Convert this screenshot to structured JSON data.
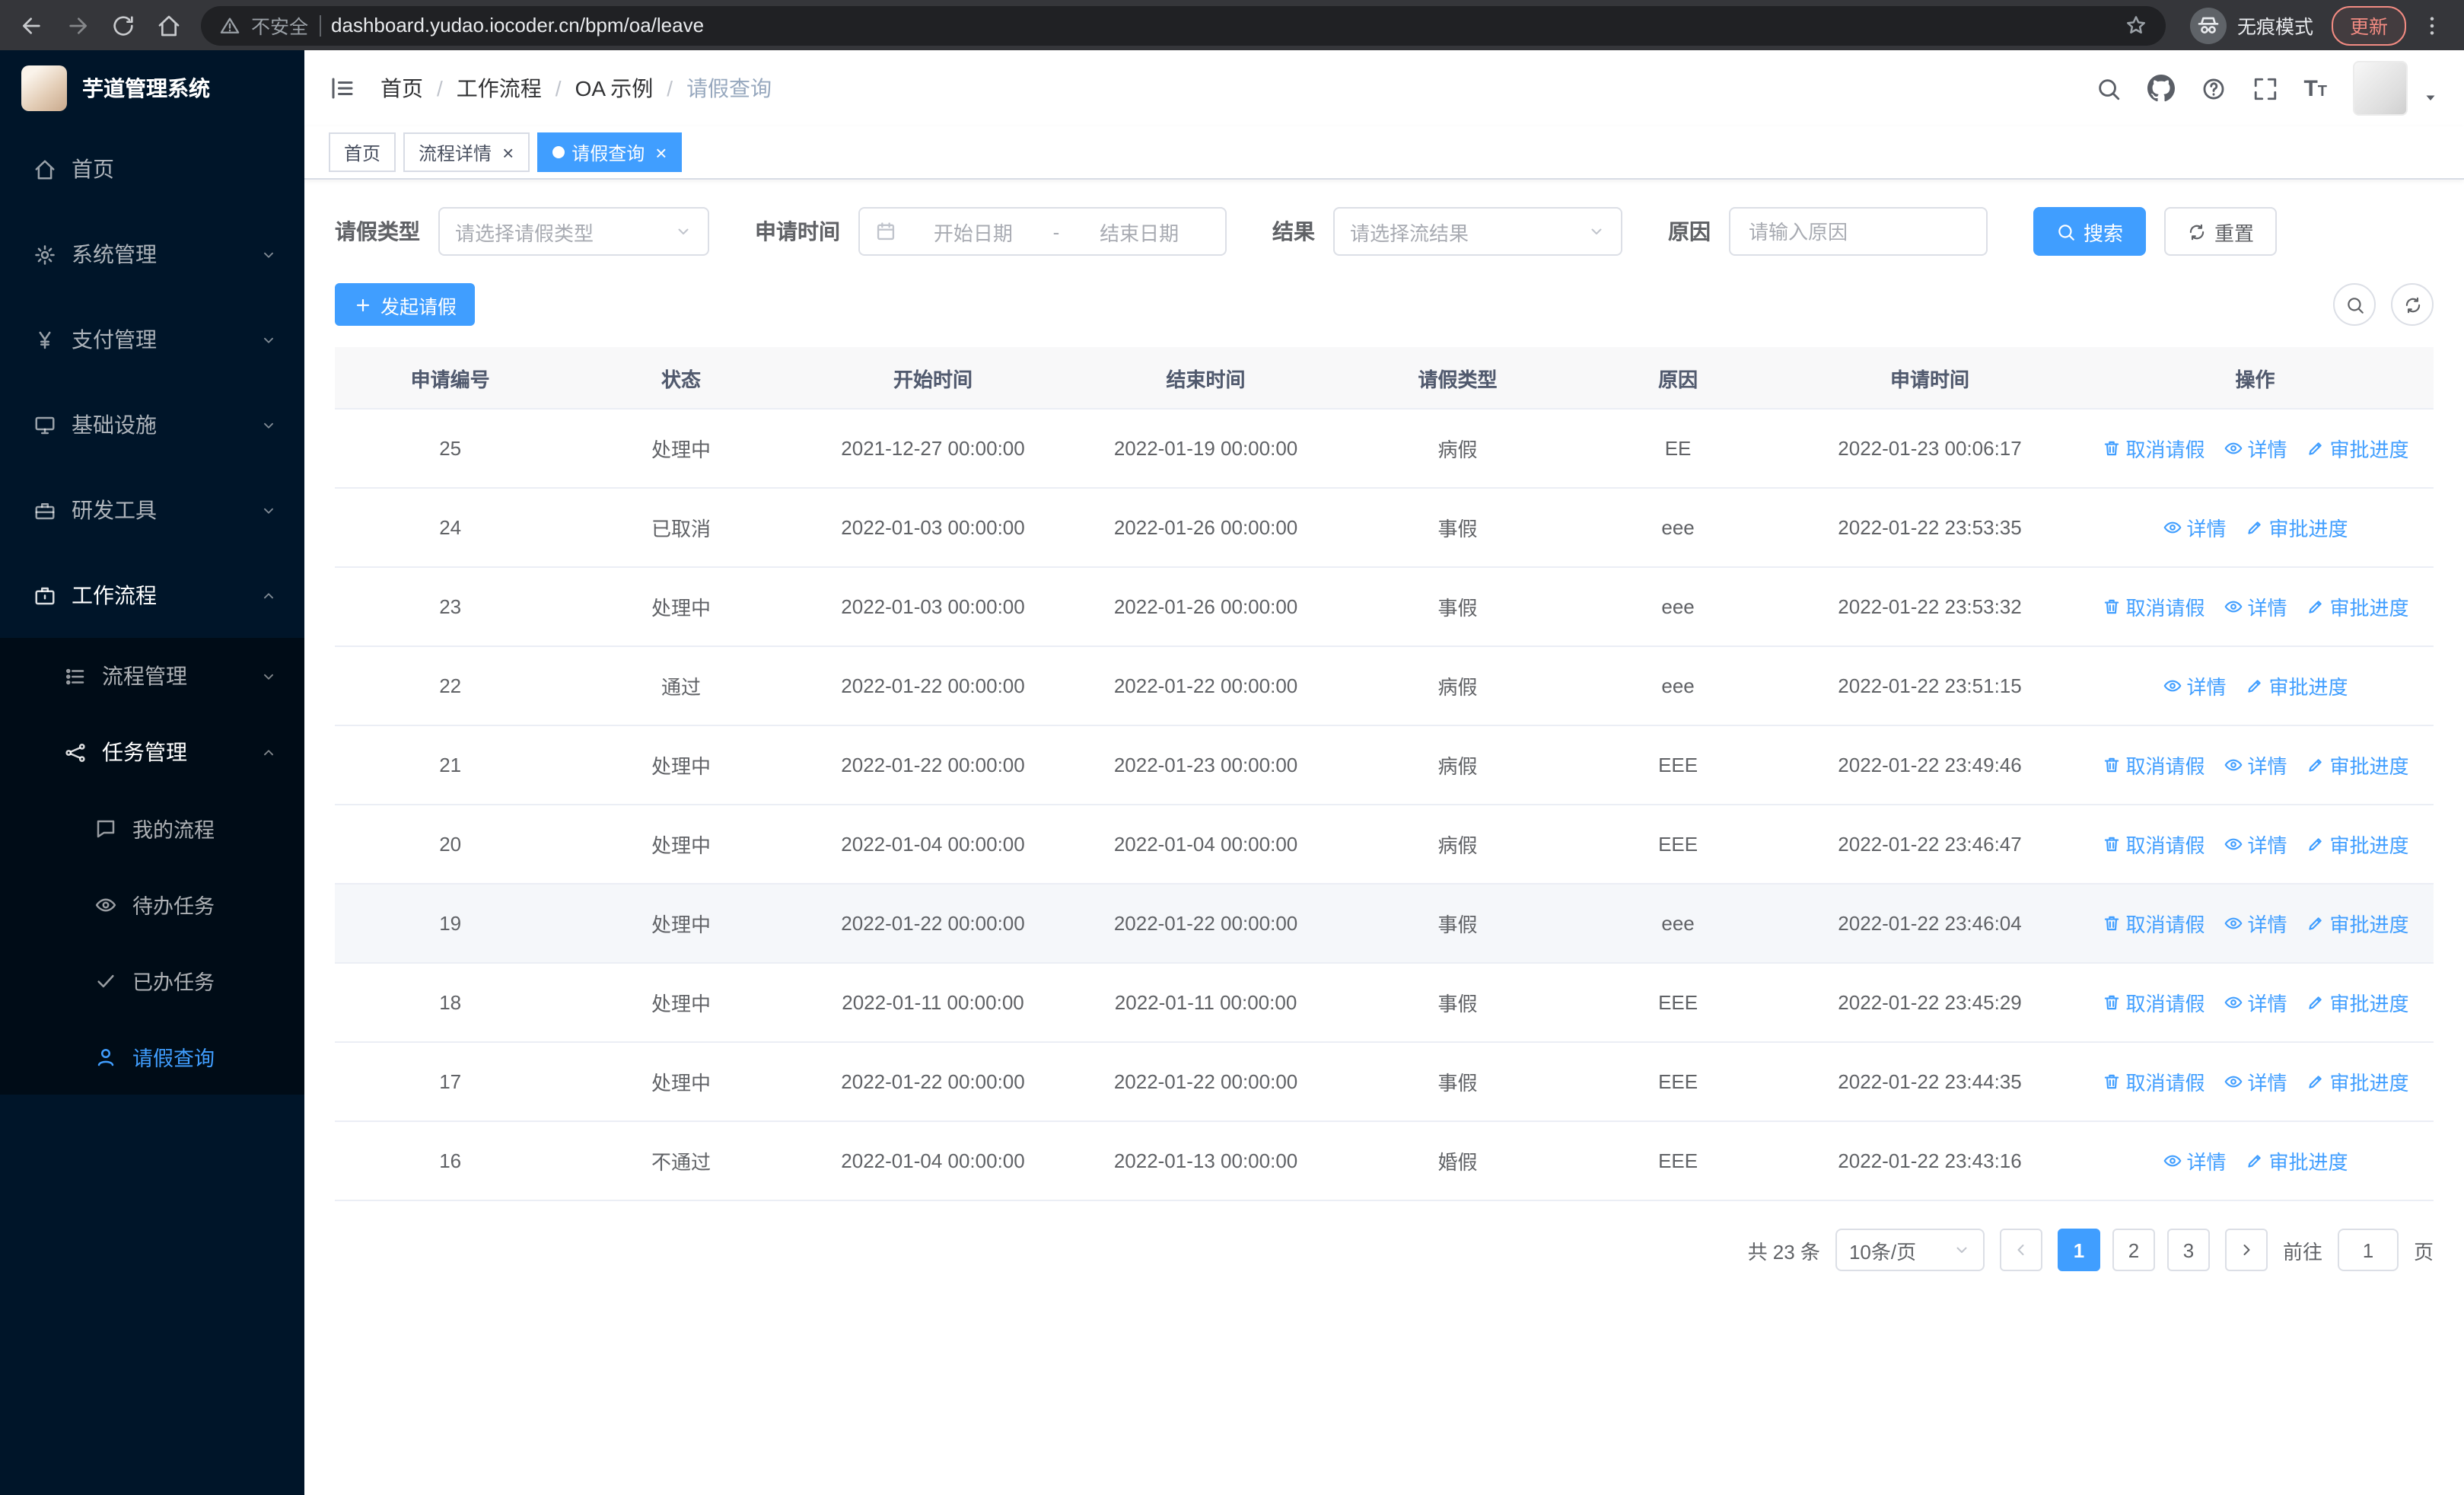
{
  "colors": {
    "accent": "#409eff",
    "sidebar_bg": "#001529",
    "submenu_bg": "#000c17"
  },
  "browser": {
    "security_label": "不安全",
    "url": "dashboard.yudao.iocoder.cn/bpm/oa/leave",
    "incognito_label": "无痕模式",
    "update_label": "更新"
  },
  "sidebar": {
    "title": "芋道管理系统",
    "items": [
      {
        "id": "home",
        "label": "首页",
        "icon": "home"
      },
      {
        "id": "system",
        "label": "系统管理",
        "icon": "gear",
        "chevron": "down"
      },
      {
        "id": "payment",
        "label": "支付管理",
        "icon": "yen",
        "chevron": "down"
      },
      {
        "id": "infrastructure",
        "label": "基础设施",
        "icon": "infra",
        "chevron": "down"
      },
      {
        "id": "devtools",
        "label": "研发工具",
        "icon": "tool",
        "chevron": "down"
      },
      {
        "id": "workflow",
        "label": "工作流程",
        "icon": "briefcase",
        "chevron": "up",
        "children": [
          {
            "id": "process-mgmt",
            "label": "流程管理",
            "icon": "flow",
            "chevron": "down"
          },
          {
            "id": "task-mgmt",
            "label": "任务管理",
            "icon": "task",
            "chevron": "up",
            "children": [
              {
                "id": "my-process",
                "label": "我的流程",
                "icon": "chat"
              },
              {
                "id": "todo-tasks",
                "label": "待办任务",
                "icon": "eye"
              },
              {
                "id": "done-tasks",
                "label": "已办任务",
                "icon": "check"
              },
              {
                "id": "leave-query",
                "label": "请假查询",
                "icon": "user",
                "active": true
              }
            ]
          }
        ]
      }
    ]
  },
  "header": {
    "breadcrumb": [
      "首页",
      "工作流程",
      "OA 示例",
      "请假查询"
    ],
    "separator": "/"
  },
  "tabs": {
    "items": [
      {
        "id": "home",
        "label": "首页",
        "closable": false,
        "active": false
      },
      {
        "id": "process-detail",
        "label": "流程详情",
        "closable": true,
        "active": false
      },
      {
        "id": "leave-query",
        "label": "请假查询",
        "closable": true,
        "active": true
      }
    ]
  },
  "filters": {
    "leave_type": {
      "label": "请假类型",
      "placeholder": "请选择请假类型"
    },
    "apply_time": {
      "label": "申请时间",
      "start_placeholder": "开始日期",
      "separator": "-",
      "end_placeholder": "结束日期"
    },
    "result": {
      "label": "结果",
      "placeholder": "请选择流结果"
    },
    "reason": {
      "label": "原因",
      "placeholder": "请输入原因"
    },
    "search_label": "搜索",
    "reset_label": "重置"
  },
  "toolbar": {
    "create_label": "发起请假"
  },
  "table": {
    "columns": [
      "申请编号",
      "状态",
      "开始时间",
      "结束时间",
      "请假类型",
      "原因",
      "申请时间",
      "操作"
    ],
    "op_defs": {
      "cancel": {
        "label": "取消请假",
        "icon": "trash"
      },
      "detail": {
        "label": "详情",
        "icon": "eye"
      },
      "progress": {
        "label": "审批进度",
        "icon": "edit"
      }
    },
    "rows": [
      {
        "id": "25",
        "status": "处理中",
        "start": "2021-12-27 00:00:00",
        "end": "2022-01-19 00:00:00",
        "type": "病假",
        "reason": "EE",
        "apply_time": "2022-01-23 00:06:17",
        "ops": [
          "cancel",
          "detail",
          "progress"
        ]
      },
      {
        "id": "24",
        "status": "已取消",
        "start": "2022-01-03 00:00:00",
        "end": "2022-01-26 00:00:00",
        "type": "事假",
        "reason": "eee",
        "apply_time": "2022-01-22 23:53:35",
        "ops": [
          "detail",
          "progress"
        ]
      },
      {
        "id": "23",
        "status": "处理中",
        "start": "2022-01-03 00:00:00",
        "end": "2022-01-26 00:00:00",
        "type": "事假",
        "reason": "eee",
        "apply_time": "2022-01-22 23:53:32",
        "ops": [
          "cancel",
          "detail",
          "progress"
        ]
      },
      {
        "id": "22",
        "status": "通过",
        "start": "2022-01-22 00:00:00",
        "end": "2022-01-22 00:00:00",
        "type": "病假",
        "reason": "eee",
        "apply_time": "2022-01-22 23:51:15",
        "ops": [
          "detail",
          "progress"
        ]
      },
      {
        "id": "21",
        "status": "处理中",
        "start": "2022-01-22 00:00:00",
        "end": "2022-01-23 00:00:00",
        "type": "病假",
        "reason": "EEE",
        "apply_time": "2022-01-22 23:49:46",
        "ops": [
          "cancel",
          "detail",
          "progress"
        ]
      },
      {
        "id": "20",
        "status": "处理中",
        "start": "2022-01-04 00:00:00",
        "end": "2022-01-04 00:00:00",
        "type": "病假",
        "reason": "EEE",
        "apply_time": "2022-01-22 23:46:47",
        "ops": [
          "cancel",
          "detail",
          "progress"
        ]
      },
      {
        "id": "19",
        "status": "处理中",
        "start": "2022-01-22 00:00:00",
        "end": "2022-01-22 00:00:00",
        "type": "事假",
        "reason": "eee",
        "apply_time": "2022-01-22 23:46:04",
        "ops": [
          "cancel",
          "detail",
          "progress"
        ],
        "highlighted": true
      },
      {
        "id": "18",
        "status": "处理中",
        "start": "2022-01-11 00:00:00",
        "end": "2022-01-11 00:00:00",
        "type": "事假",
        "reason": "EEE",
        "apply_time": "2022-01-22 23:45:29",
        "ops": [
          "cancel",
          "detail",
          "progress"
        ]
      },
      {
        "id": "17",
        "status": "处理中",
        "start": "2022-01-22 00:00:00",
        "end": "2022-01-22 00:00:00",
        "type": "事假",
        "reason": "EEE",
        "apply_time": "2022-01-22 23:44:35",
        "ops": [
          "cancel",
          "detail",
          "progress"
        ]
      },
      {
        "id": "16",
        "status": "不通过",
        "start": "2022-01-04 00:00:00",
        "end": "2022-01-13 00:00:00",
        "type": "婚假",
        "reason": "EEE",
        "apply_time": "2022-01-22 23:43:16",
        "ops": [
          "detail",
          "progress"
        ]
      }
    ]
  },
  "pagination": {
    "total_label": "共 23 条",
    "page_size_label": "10条/页",
    "pages": [
      "1",
      "2",
      "3"
    ],
    "active_page": "1",
    "goto_label": "前往",
    "goto_value": "1",
    "goto_suffix": "页"
  }
}
